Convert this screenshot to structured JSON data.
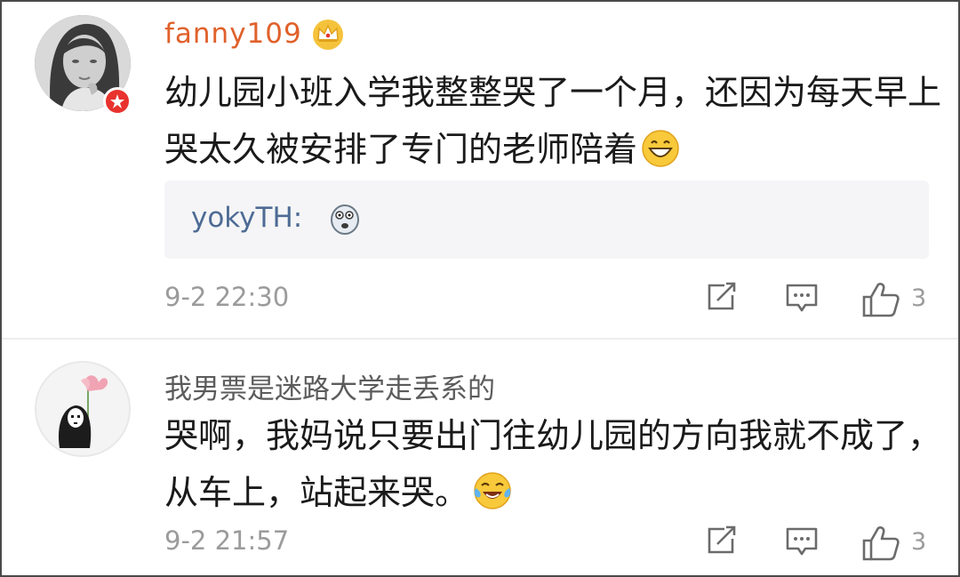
{
  "comments": [
    {
      "username": "fanny109",
      "username_badge": "crown-icon",
      "avatar_badge": "vip-star-icon",
      "text": "幼儿园小班入学我整整哭了一个月，还因为每天早上哭太久被安排了专门的老师陪着",
      "text_emoji": "grinning-emoji",
      "reply": {
        "author": "yokyTH",
        "text": "yokyTH: ",
        "emoji": "shocked-face-emoji"
      },
      "time": "9-2 22:30",
      "likes": "3"
    },
    {
      "username": "我男票是迷路大学走丢系的",
      "text": "哭啊，我妈说只要出门往幼儿园的方向我就不成了，从车上，站起来哭。",
      "text_emoji": "laughing-tears-emoji",
      "time": "9-2 21:57",
      "likes": "3"
    }
  ],
  "actions": [
    "share-icon",
    "comment-icon",
    "like-icon"
  ],
  "colors": {
    "username_vip": "#e0612b",
    "username": "#5b5b5b",
    "reply_link": "#4d6b94",
    "meta": "#9b9b9b",
    "badge": "#e8332e"
  }
}
